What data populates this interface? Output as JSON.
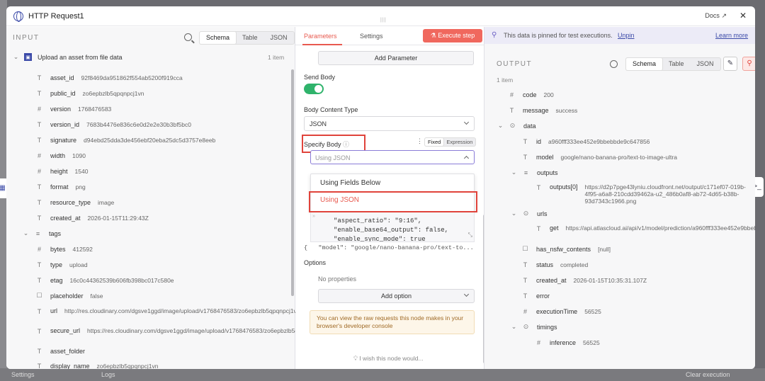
{
  "backdrop": {
    "settings_label": "Settings",
    "logs_label": "Logs",
    "clear_label": "Clear execution"
  },
  "modal": {
    "title": "HTTP Request1",
    "docs_label": "Docs",
    "close_glyph": "✕"
  },
  "input": {
    "header": "INPUT",
    "views": [
      "Schema",
      "Table",
      "JSON"
    ],
    "node_name": "Upload an asset from file data",
    "item_count": "1 item",
    "fields": [
      {
        "icon": "T",
        "key": "asset_id",
        "value": "92f8469da951862f554ab5200f919cca"
      },
      {
        "icon": "T",
        "key": "public_id",
        "value": "zo6epbzlb5qpqnpcj1vn"
      },
      {
        "icon": "#",
        "key": "version",
        "value": "1768476583"
      },
      {
        "icon": "T",
        "key": "version_id",
        "value": "7683b4476e836c6e0d2e2e30b3bf5bc0"
      },
      {
        "icon": "T",
        "key": "signature",
        "value": "d94ebd25dda3de456ebf20eba25dc5d3757e8eeb"
      },
      {
        "icon": "#",
        "key": "width",
        "value": "1090"
      },
      {
        "icon": "#",
        "key": "height",
        "value": "1540"
      },
      {
        "icon": "T",
        "key": "format",
        "value": "png"
      },
      {
        "icon": "T",
        "key": "resource_type",
        "value": "image"
      },
      {
        "icon": "T",
        "key": "created_at",
        "value": "2026-01-15T11:29:43Z"
      },
      {
        "icon": "≡",
        "key": "tags",
        "value": ""
      },
      {
        "icon": "#",
        "key": "bytes",
        "value": "412592"
      },
      {
        "icon": "T",
        "key": "type",
        "value": "upload"
      },
      {
        "icon": "T",
        "key": "etag",
        "value": "16c0c44362539b606fb398bc017c580e"
      },
      {
        "icon": "☐",
        "key": "placeholder",
        "value": "false"
      },
      {
        "icon": "T",
        "key": "url",
        "value": "http://res.cloudinary.com/dgsve1ggd/image/upload/v1768476583/zo6epbzlb5qpqnpcj1vn.png"
      },
      {
        "icon": "T",
        "key": "secure_url",
        "value": "https://res.cloudinary.com/dgsve1ggd/image/upload/v1768476583/zo6epbzlb5qpqnpcj1vn.png"
      },
      {
        "icon": "T",
        "key": "asset_folder",
        "value": ""
      },
      {
        "icon": "T",
        "key": "display_name",
        "value": "zo6epbzlb5qpqnpcj1vn"
      }
    ]
  },
  "params": {
    "tabs": [
      "Parameters",
      "Settings"
    ],
    "execute_label": "Execute step",
    "add_parameter": "Add Parameter",
    "send_body_label": "Send Body",
    "body_content_type_label": "Body Content Type",
    "body_content_type_value": "JSON",
    "specify_body_label": "Specify Body",
    "fixed_label": "Fixed",
    "expression_label": "Expression",
    "specify_body_value": "Using JSON",
    "dropdown_options": [
      "Using Fields Below",
      "Using JSON"
    ],
    "code_lines": [
      "\"aspect_ratio\": \"9:16\",",
      "\"enable_base64_output\": false,",
      "\"enable_sync_mode\": true"
    ],
    "code_preview": "{   \"model\": \"google/nano-banana-pro/text-to...",
    "options_label": "Options",
    "no_properties": "No properties",
    "add_option": "Add option",
    "note": "You can view the raw requests this node makes in your browser's developer console",
    "wish_label": "I wish this node would..."
  },
  "output": {
    "pinned_text": "This data is pinned for test executions.",
    "unpin_label": "Unpin",
    "learn_more": "Learn more",
    "header": "OUTPUT",
    "views": [
      "Schema",
      "Table",
      "JSON"
    ],
    "item_count": "1 item",
    "fields": [
      {
        "icon": "#",
        "key": "code",
        "value": "200"
      },
      {
        "icon": "T",
        "key": "message",
        "value": "success"
      },
      {
        "icon": "⊙",
        "key": "data",
        "value": ""
      },
      {
        "icon": "T",
        "key": "id",
        "value": "a960fff333ee452e9bbebbde9c647856"
      },
      {
        "icon": "T",
        "key": "model",
        "value": "google/nano-banana-pro/text-to-image-ultra"
      },
      {
        "icon": "≡",
        "key": "outputs",
        "value": ""
      },
      {
        "icon": "T",
        "key": "outputs[0]",
        "value": "https://d2p7pge43lyniu.cloudfront.net/output/c171ef07-019b-4f95-a6a8-210cdd39462a-u2_486b0af8-ab72-4d65-b38b-93d7343c1966.png"
      },
      {
        "icon": "⊙",
        "key": "urls",
        "value": ""
      },
      {
        "icon": "T",
        "key": "get",
        "value": "https://api.atlascloud.ai/api/v1/model/prediction/a960fff333ee452e9bbebbde9c647856"
      },
      {
        "icon": "☐",
        "key": "has_nsfw_contents",
        "value": "[null]"
      },
      {
        "icon": "T",
        "key": "status",
        "value": "completed"
      },
      {
        "icon": "T",
        "key": "created_at",
        "value": "2026-01-15T10:35:31.107Z"
      },
      {
        "icon": "T",
        "key": "error",
        "value": ""
      },
      {
        "icon": "#",
        "key": "executionTime",
        "value": "56525"
      },
      {
        "icon": "⊙",
        "key": "timings",
        "value": ""
      },
      {
        "icon": "#",
        "key": "inference",
        "value": "56525"
      }
    ]
  },
  "colors": {
    "accent": "#f0685e",
    "toggle_on": "#2fb36b",
    "highlight": "#e0433b"
  }
}
